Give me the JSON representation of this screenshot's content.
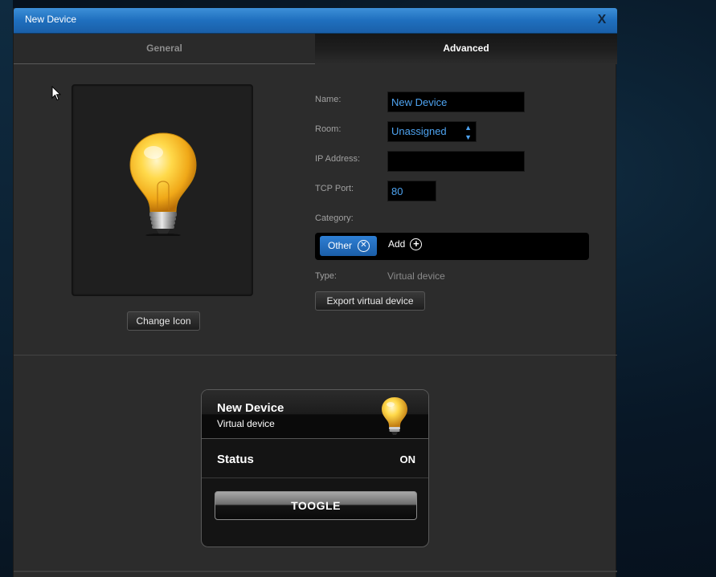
{
  "window": {
    "title": "New Device",
    "close_label": "X"
  },
  "tabs": [
    {
      "label": "General",
      "active": false
    },
    {
      "label": "Advanced",
      "active": true
    }
  ],
  "icon_panel": {
    "icon": "lightbulb-icon",
    "change_button": "Change Icon"
  },
  "form": {
    "name": {
      "label": "Name:",
      "value": "New Device"
    },
    "room": {
      "label": "Room:",
      "value": "Unassigned"
    },
    "ip": {
      "label": "IP Address:",
      "value": ""
    },
    "port": {
      "label": "TCP Port:",
      "value": "80"
    },
    "category": {
      "label": "Category:",
      "tags": [
        "Other"
      ],
      "add_label": "Add"
    },
    "type": {
      "label": "Type:",
      "value": "Virtual device"
    },
    "export_button": "Export virtual device"
  },
  "preview_card": {
    "title": "New Device",
    "subtitle": "Virtual device",
    "icon": "lightbulb-icon",
    "status_label": "Status",
    "status_value": "ON",
    "toggle_label": "TOOGLE"
  },
  "colors": {
    "accent": "#1f6fbe",
    "input_text": "#4ea3f0",
    "tag_bg": "#2e7fd4",
    "dialog_bg": "#2c2c2c"
  }
}
